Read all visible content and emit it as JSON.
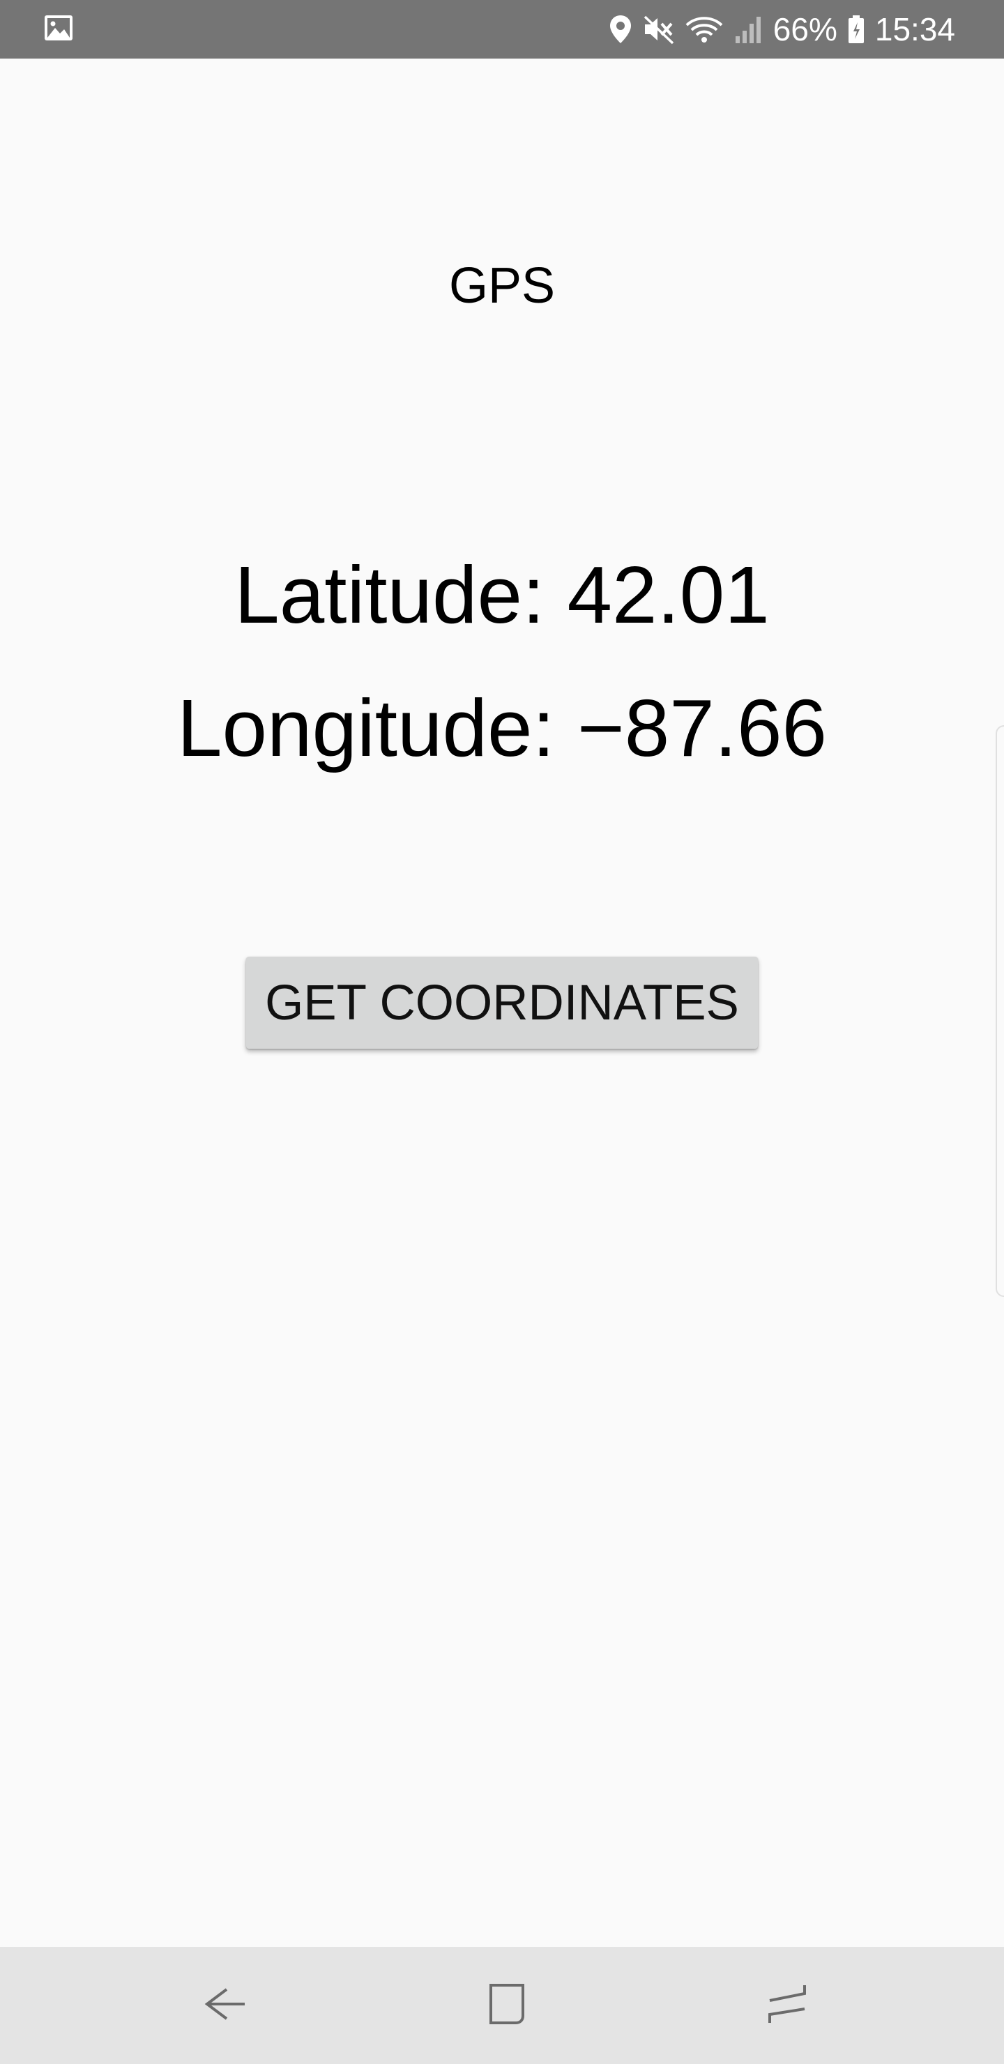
{
  "status_bar": {
    "battery": "66%",
    "time": "15:34",
    "icons": [
      "image-icon",
      "location-icon",
      "mute-icon",
      "wifi-icon",
      "signal-icon",
      "battery-icon"
    ]
  },
  "app": {
    "title": "GPS",
    "latitude_text": "Latitude: 42.01",
    "longitude_text": "Longitude: −87.66",
    "button_label": "GET COORDINATES"
  },
  "nav_bar": {
    "icons": [
      "back-icon",
      "home-icon",
      "recent-apps-icon"
    ]
  },
  "colors": {
    "status_bar_bg": "#757575",
    "page_bg": "#fafafa",
    "button_bg": "#d6d7d7",
    "nav_bar_bg": "#e4e4e4"
  }
}
